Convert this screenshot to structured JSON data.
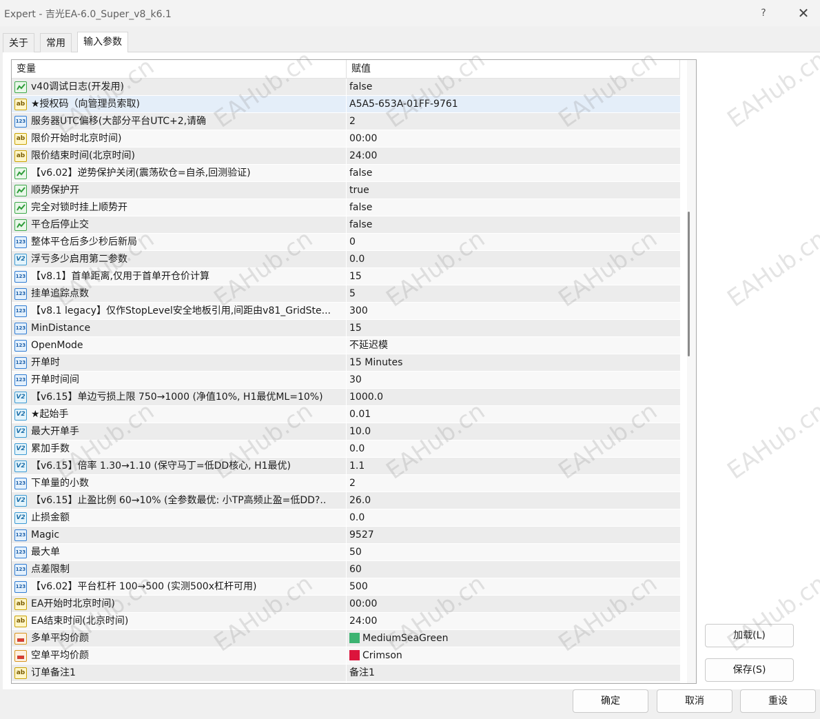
{
  "window": {
    "title": "Expert - 吉光EA-6.0_Super_v8_k6.1",
    "help": "?",
    "close": "✕"
  },
  "tabs": [
    {
      "label": "关于"
    },
    {
      "label": "常用"
    },
    {
      "label": "输入参数"
    }
  ],
  "grid": {
    "headers": {
      "variable": "变量",
      "value": "赋值"
    },
    "rows": [
      {
        "type": "bool",
        "name": "v40调试日志(开发用)",
        "value": "false"
      },
      {
        "type": "str",
        "name": "★授权码（向管理员索取)",
        "value": "A5A5-653A-01FF-9761"
      },
      {
        "type": "int",
        "name": "服务器UTC偏移(大部分平台UTC+2,请确",
        "value": "2"
      },
      {
        "type": "str",
        "name": "限价开始时北京时间)",
        "value": "00:00"
      },
      {
        "type": "str",
        "name": "限价结束时间(北京时间)",
        "value": "24:00"
      },
      {
        "type": "bool",
        "name": "【v6.02】逆势保护关闭(震荡砍仓=自杀,回测验证)",
        "value": "false"
      },
      {
        "type": "bool",
        "name": "顺势保护开",
        "value": "true"
      },
      {
        "type": "bool",
        "name": "完全对锁时挂上顺势开",
        "value": "false"
      },
      {
        "type": "bool",
        "name": "平仓后停止交",
        "value": "false"
      },
      {
        "type": "int",
        "name": "整体平仓后多少秒后新局",
        "value": "0"
      },
      {
        "type": "dbl",
        "name": "浮亏多少启用第二参数",
        "value": "0.0"
      },
      {
        "type": "int",
        "name": "【v8.1】首单距离,仅用于首单开仓价计算",
        "value": "15"
      },
      {
        "type": "int",
        "name": "挂单追踪点数",
        "value": "5"
      },
      {
        "type": "int",
        "name": "【v8.1 legacy】仅作StopLevel安全地板引用,间距由v81_GridSte...",
        "value": "300"
      },
      {
        "type": "int",
        "name": "MinDistance",
        "value": "15"
      },
      {
        "type": "int",
        "name": "OpenMode",
        "value": "不延迟模"
      },
      {
        "type": "int",
        "name": "开单时",
        "value": "15 Minutes"
      },
      {
        "type": "int",
        "name": "开单时间间",
        "value": "30"
      },
      {
        "type": "dbl",
        "name": "【v6.15】单边亏损上限 750→1000 (净值10%, H1最优ML=10%)",
        "value": "1000.0"
      },
      {
        "type": "dbl",
        "name": "★起始手",
        "value": "0.01"
      },
      {
        "type": "dbl",
        "name": "最大开单手",
        "value": "10.0"
      },
      {
        "type": "dbl",
        "name": "累加手数",
        "value": "0.0"
      },
      {
        "type": "dbl",
        "name": "【v6.15】倍率 1.30→1.10 (保守马丁=低DD核心, H1最优)",
        "value": "1.1"
      },
      {
        "type": "int",
        "name": "下单量的小数",
        "value": "2"
      },
      {
        "type": "dbl",
        "name": "【v6.15】止盈比例 60→10% (全参数最优: 小TP高频止盈=低DD?..",
        "value": "26.0"
      },
      {
        "type": "dbl",
        "name": "止损金额",
        "value": "0.0"
      },
      {
        "type": "int",
        "name": "Magic",
        "value": "9527"
      },
      {
        "type": "int",
        "name": "最大单",
        "value": "50"
      },
      {
        "type": "int",
        "name": "点差限制",
        "value": "60"
      },
      {
        "type": "int",
        "name": "【v6.02】平台杠杆 100→500 (实测500x杠杆可用)",
        "value": "500"
      },
      {
        "type": "str",
        "name": "EA开始时北京时间)",
        "value": "00:00"
      },
      {
        "type": "str",
        "name": "EA结束时间(北京时间)",
        "value": "24:00"
      },
      {
        "type": "color",
        "name": "多单平均价颜",
        "value": "MediumSeaGreen",
        "swatch": "#3cb371"
      },
      {
        "type": "color",
        "name": "空单平均价颜",
        "value": "Crimson",
        "swatch": "#dc143c"
      },
      {
        "type": "str",
        "name": "订单备注1",
        "value": "备注1"
      },
      {
        "type": "str",
        "name": "",
        "value": ""
      }
    ],
    "selected_index": 1
  },
  "icons": {
    "bool": "bool-toggle-icon",
    "str": "string-ab-icon",
    "int": "integer-123-icon",
    "dbl": "double-v2-icon",
    "color": "color-palette-icon"
  },
  "icon_text": {
    "str": "ab",
    "int": "123",
    "dbl": "V2"
  },
  "buttons": {
    "load": "加载(L)",
    "save": "保存(S)",
    "ok": "确定",
    "cancel": "取消",
    "reset": "重设"
  },
  "watermark": "EAHub.cn"
}
